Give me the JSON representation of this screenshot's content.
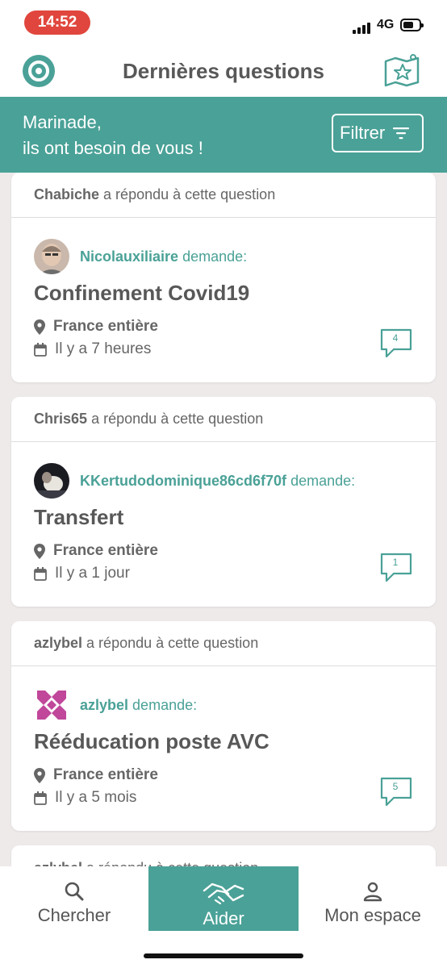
{
  "status_bar": {
    "time": "14:52",
    "network": "4G"
  },
  "header": {
    "title": "Dernières questions"
  },
  "banner": {
    "line1": "Marinade,",
    "line2": "ils ont besoin de vous !",
    "filter_label": "Filtrer"
  },
  "cards": [
    {
      "answerer": "Chabiche",
      "answered_text": "a répondu à cette question",
      "asker": "Nicolauxiliaire",
      "asks_text": "demande:",
      "question": "Confinement Covid19",
      "location": "France entière",
      "time": "Il y a 7 heures",
      "reply_count": "4"
    },
    {
      "answerer": "Chris65",
      "answered_text": "a répondu à cette question",
      "asker": "KKertudodominique86cd6f70f",
      "asks_text": "demande:",
      "question": "Transfert",
      "location": "France entière",
      "time": "Il y a 1 jour",
      "reply_count": "1"
    },
    {
      "answerer": "azlybel",
      "answered_text": "a répondu à cette question",
      "asker": "azlybel",
      "asks_text": "demande:",
      "question": "Rééducation poste AVC",
      "location": "France entière",
      "time": "Il y a 5 mois",
      "reply_count": "5"
    },
    {
      "answerer": "azlybel",
      "answered_text": "a répondu à cette question"
    }
  ],
  "tabbar": {
    "search": "Chercher",
    "help": "Aider",
    "profile": "Mon espace"
  },
  "colors": {
    "accent": "#4aa197",
    "time_pill": "#e0463d"
  }
}
